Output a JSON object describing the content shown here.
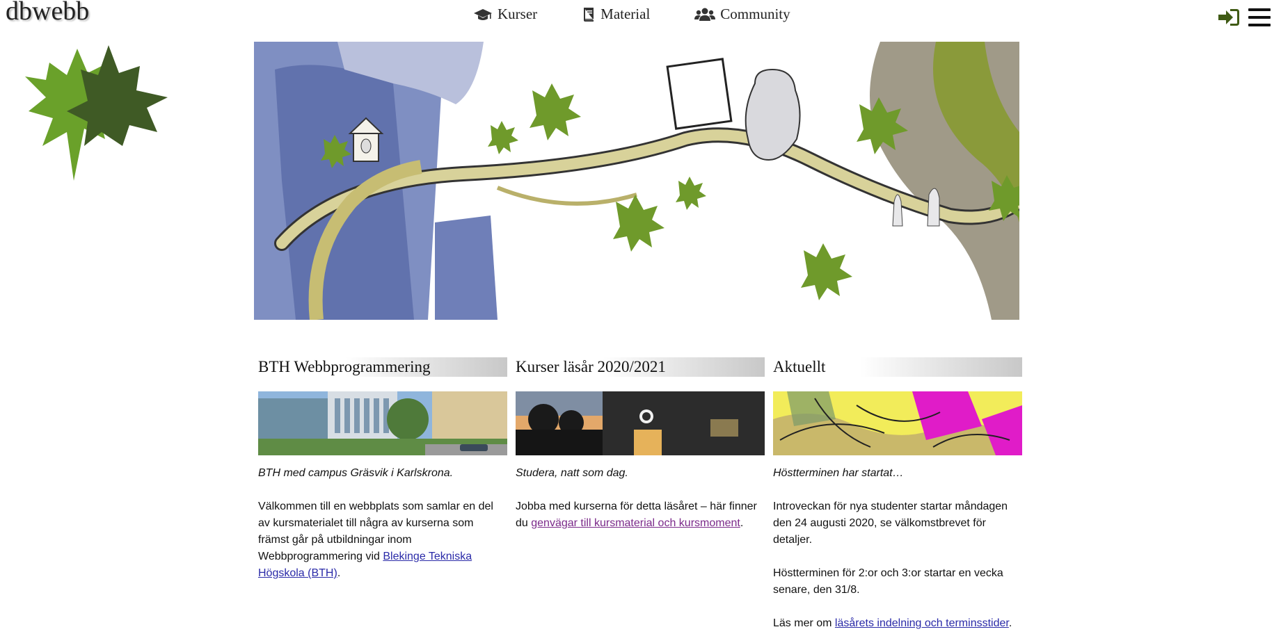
{
  "site": {
    "title": "dbwebb"
  },
  "nav": {
    "items": [
      {
        "label": "Kurser",
        "icon": "graduation-cap-icon"
      },
      {
        "label": "Material",
        "icon": "book-icon"
      },
      {
        "label": "Community",
        "icon": "users-icon"
      }
    ]
  },
  "header_actions": {
    "login_icon": "sign-in-icon",
    "menu_icon": "hamburger-menu-icon",
    "login_color": "#3f5a14"
  },
  "colors": {
    "link": "#2a2aa8",
    "visited_link": "#7b2a8a",
    "leaf_light": "#6aa12a",
    "leaf_dark": "#3f5a25"
  },
  "columns": [
    {
      "heading": "BTH Webbprogrammering",
      "caption": "BTH med campus Gräsvik i Karlskrona.",
      "text_before": "Välkommen till en webbplats som samlar en del av kursmaterialet till några av kurserna som främst går på utbildningar inom Webbprogrammering vid ",
      "link": "Blekinge Tekniska Högskola (BTH)",
      "text_after": "."
    },
    {
      "heading": "Kurser läsår 2020/2021",
      "caption": "Studera, natt som dag.",
      "text_before": "Jobba med kurserna för detta läsåret – här finner du ",
      "link": "genvägar till kursmaterial och kursmoment",
      "text_after": "."
    },
    {
      "heading": "Aktuellt",
      "caption": "Höstterminen har startat…",
      "para1": "Introveckan för nya studenter startar måndagen den 24 augusti 2020, se välkomstbrevet för detaljer.",
      "para2": "Höstterminen för 2:or och 3:or startar en vecka senare, den 31/8.",
      "text_before": "Läs mer om ",
      "link": "läsårets indelning och terminsstider",
      "text_after": "."
    }
  ]
}
